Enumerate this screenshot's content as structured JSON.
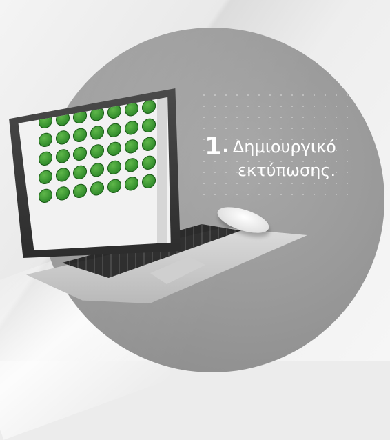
{
  "step": {
    "number": "1",
    "dot": ".",
    "line1": "Δημιουργικό",
    "line2": "εκτύπωσης."
  },
  "illustration": {
    "sticker_count": 35,
    "sticker_color": "#2f8a2a",
    "circle_color": "#9a9a9a"
  }
}
